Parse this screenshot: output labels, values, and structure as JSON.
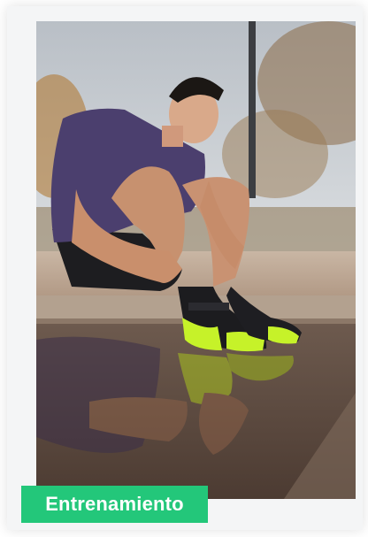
{
  "badge": {
    "label": "Entrenamiento",
    "color": "#23c77a",
    "text_color": "#ffffff"
  },
  "photo": {
    "subject": "training-photo"
  }
}
